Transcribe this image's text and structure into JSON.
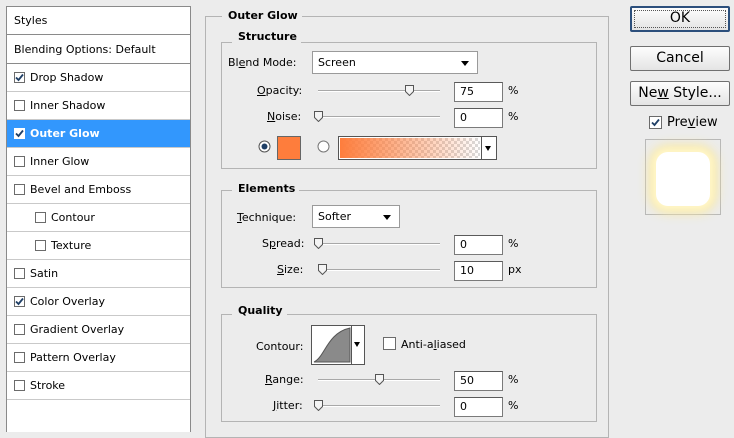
{
  "left": {
    "header": "Styles",
    "blending": "Blending Options: Default",
    "items": [
      {
        "label": "Drop Shadow",
        "checked": true,
        "selected": false,
        "sub": false
      },
      {
        "label": "Inner Shadow",
        "checked": false,
        "selected": false,
        "sub": false
      },
      {
        "label": "Outer Glow",
        "checked": true,
        "selected": true,
        "sub": false
      },
      {
        "label": "Inner Glow",
        "checked": false,
        "selected": false,
        "sub": false
      },
      {
        "label": "Bevel and Emboss",
        "checked": false,
        "selected": false,
        "sub": false
      },
      {
        "label": "Contour",
        "checked": false,
        "selected": false,
        "sub": true
      },
      {
        "label": "Texture",
        "checked": false,
        "selected": false,
        "sub": true
      },
      {
        "label": "Satin",
        "checked": false,
        "selected": false,
        "sub": false
      },
      {
        "label": "Color Overlay",
        "checked": true,
        "selected": false,
        "sub": false
      },
      {
        "label": "Gradient Overlay",
        "checked": false,
        "selected": false,
        "sub": false
      },
      {
        "label": "Pattern Overlay",
        "checked": false,
        "selected": false,
        "sub": false
      },
      {
        "label": "Stroke",
        "checked": false,
        "selected": false,
        "sub": false
      }
    ]
  },
  "panel": {
    "title": "Outer Glow",
    "structure": {
      "title": "Structure",
      "blend_mode_pre": "Bl",
      "blend_mode_u": "e",
      "blend_mode_post": "nd Mode:",
      "blend_mode_value": "Screen",
      "opacity_u": "O",
      "opacity_post": "pacity:",
      "opacity_value": "75",
      "opacity_level": 0.75,
      "noise_u": "N",
      "noise_post": "oise:",
      "noise_value": "0",
      "noise_level": 0,
      "percent": "%",
      "glow_color": "#fe7d3c",
      "color_mode": "solid"
    },
    "elements": {
      "title": "Elements",
      "technique_u": "T",
      "technique_post": "echnique:",
      "technique_value": "Softer",
      "spread_pre": "S",
      "spread_u": "p",
      "spread_post": "read:",
      "spread_value": "0",
      "spread_level": 0,
      "size_u": "S",
      "size_post": "ize:",
      "size_value": "10",
      "size_level": 0.04,
      "percent": "%",
      "px": "px"
    },
    "quality": {
      "title": "Quality",
      "contour_label": "Contour:",
      "antialias_pre": "Anti-a",
      "antialias_u": "l",
      "antialias_post": "iased",
      "antialiased": false,
      "range_u": "R",
      "range_post": "ange:",
      "range_value": "50",
      "range_level": 0.5,
      "jitter_u": "J",
      "jitter_post": "itter:",
      "jitter_value": "0",
      "jitter_level": 0,
      "percent": "%"
    }
  },
  "buttons": {
    "ok": "OK",
    "cancel": "Cancel",
    "new_style_pre": "Ne",
    "new_style_u": "w",
    "new_style_post": " Style...",
    "preview_pre": "Pre",
    "preview_u": "v",
    "preview_post": "iew",
    "preview_checked": true
  }
}
